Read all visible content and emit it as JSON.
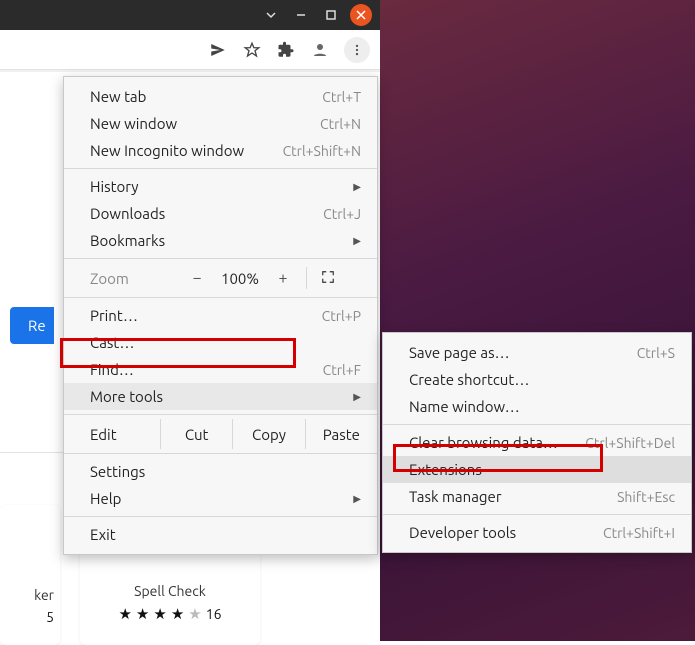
{
  "window": {
    "buttons": {
      "dropdown": "⌄",
      "min": "—",
      "max": "☐",
      "close": "✕"
    }
  },
  "toolbar": {
    "icons": {
      "send": "send-icon",
      "star": "star-icon",
      "puzzle": "extensions-icon",
      "user": "profile-icon",
      "kebab": "menu-icon"
    }
  },
  "page": {
    "blue_button": "Re",
    "card_cut": {
      "title_tail": "ker",
      "rating_tail": "5"
    },
    "card_spell": {
      "title": "Spell Check",
      "rating_count": "16",
      "stars": 4
    }
  },
  "menu": {
    "new_tab": {
      "label": "New tab",
      "shortcut": "Ctrl+T"
    },
    "new_window": {
      "label": "New window",
      "shortcut": "Ctrl+N"
    },
    "incognito": {
      "label": "New Incognito window",
      "shortcut": "Ctrl+Shift+N"
    },
    "history": {
      "label": "History"
    },
    "downloads": {
      "label": "Downloads",
      "shortcut": "Ctrl+J"
    },
    "bookmarks": {
      "label": "Bookmarks"
    },
    "zoom": {
      "label": "Zoom",
      "minus": "−",
      "value": "100%",
      "plus": "+",
      "fullscreen": "⛶"
    },
    "print": {
      "label": "Print…",
      "shortcut": "Ctrl+P"
    },
    "cast": {
      "label": "Cast…"
    },
    "find": {
      "label": "Find…",
      "shortcut": "Ctrl+F"
    },
    "more_tools": {
      "label": "More tools"
    },
    "edit": {
      "label": "Edit",
      "cut": "Cut",
      "copy": "Copy",
      "paste": "Paste"
    },
    "settings": {
      "label": "Settings"
    },
    "help": {
      "label": "Help"
    },
    "exit": {
      "label": "Exit"
    }
  },
  "submenu": {
    "save_as": {
      "label": "Save page as…",
      "shortcut": "Ctrl+S"
    },
    "create_shortcut": {
      "label": "Create shortcut…"
    },
    "name_window": {
      "label": "Name window…"
    },
    "clear_data": {
      "label": "Clear browsing data…",
      "shortcut": "Ctrl+Shift+Del"
    },
    "extensions": {
      "label": "Extensions"
    },
    "task_manager": {
      "label": "Task manager",
      "shortcut": "Shift+Esc"
    },
    "dev_tools": {
      "label": "Developer tools",
      "shortcut": "Ctrl+Shift+I"
    }
  }
}
